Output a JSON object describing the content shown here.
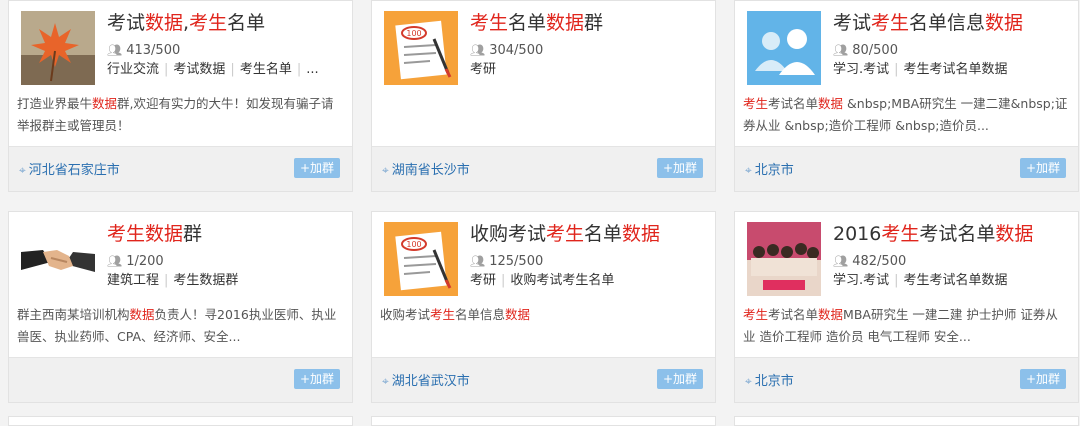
{
  "colors": {
    "highlight": "#e0251c",
    "location": "#2a6fb0",
    "join_button": "#8cc0ea"
  },
  "join_label": "+加群",
  "cards": [
    {
      "avatar": "maple-leaf-photo",
      "title": [
        {
          "t": "考试"
        },
        {
          "t": "数据",
          "hl": true
        },
        {
          "t": ","
        },
        {
          "t": "考生",
          "hl": true
        },
        {
          "t": "名单"
        }
      ],
      "members": "413/500",
      "tags": [
        "行业交流",
        "考试数据",
        "考生名单",
        "..."
      ],
      "desc": [
        {
          "t": "打造业界最牛"
        },
        {
          "t": "数据",
          "hl": true
        },
        {
          "t": "群,欢迎有实力的大牛！如发现有骗子请举报群主或管理员！"
        }
      ],
      "location": "河北省石家庄市"
    },
    {
      "avatar": "exam-paper-icon",
      "title": [
        {
          "t": "考生",
          "hl": true
        },
        {
          "t": "名单"
        },
        {
          "t": "数据",
          "hl": true
        },
        {
          "t": "群"
        }
      ],
      "members": "304/500",
      "tags": [
        "考研"
      ],
      "desc": [],
      "location": "湖南省长沙市"
    },
    {
      "avatar": "default-group-avatar",
      "title": [
        {
          "t": "考试"
        },
        {
          "t": "考生",
          "hl": true
        },
        {
          "t": "名单信息"
        },
        {
          "t": "数据",
          "hl": true
        }
      ],
      "members": "80/500",
      "tags": [
        "学习.考试",
        "考生考试名单数据"
      ],
      "desc": [
        {
          "t": "考生",
          "hl": true
        },
        {
          "t": "考试名单"
        },
        {
          "t": "数据",
          "hl": true
        },
        {
          "t": " &nbsp;MBA研究生 一建二建&nbsp;证券从业 &nbsp;造价工程师 &nbsp;造价员..."
        }
      ],
      "location": "北京市"
    },
    {
      "avatar": "handshake-photo",
      "title": [
        {
          "t": "考生",
          "hl": true
        },
        {
          "t": "数据",
          "hl": true
        },
        {
          "t": "群"
        }
      ],
      "members": "1/200",
      "tags": [
        "建筑工程",
        "考生数据群"
      ],
      "desc": [
        {
          "t": "群主西南某培训机构"
        },
        {
          "t": "数据",
          "hl": true
        },
        {
          "t": "负责人！寻2016执业医师、执业兽医、执业药师、CPA、经济师、安全..."
        }
      ],
      "location": ""
    },
    {
      "avatar": "exam-paper-icon",
      "title": [
        {
          "t": "收购考试"
        },
        {
          "t": "考生",
          "hl": true
        },
        {
          "t": "名单"
        },
        {
          "t": "数据",
          "hl": true
        }
      ],
      "members": "125/500",
      "tags": [
        "考研",
        "收购考试考生名单"
      ],
      "desc": [
        {
          "t": "收购考试"
        },
        {
          "t": "考生",
          "hl": true
        },
        {
          "t": "名单信息"
        },
        {
          "t": "数据",
          "hl": true
        }
      ],
      "location": "湖北省武汉市"
    },
    {
      "avatar": "group-photo",
      "title": [
        {
          "t": "2016"
        },
        {
          "t": "考生",
          "hl": true
        },
        {
          "t": "考试名单"
        },
        {
          "t": "数据",
          "hl": true
        }
      ],
      "members": "482/500",
      "tags": [
        "学习.考试",
        "考生考试名单数据"
      ],
      "desc": [
        {
          "t": "考生",
          "hl": true
        },
        {
          "t": "考试名单"
        },
        {
          "t": "数据",
          "hl": true
        },
        {
          "t": "MBA研究生 一建二建 护士护师 证券从业 造价工程师 造价员 电气工程师 安全..."
        }
      ],
      "location": "北京市"
    }
  ]
}
